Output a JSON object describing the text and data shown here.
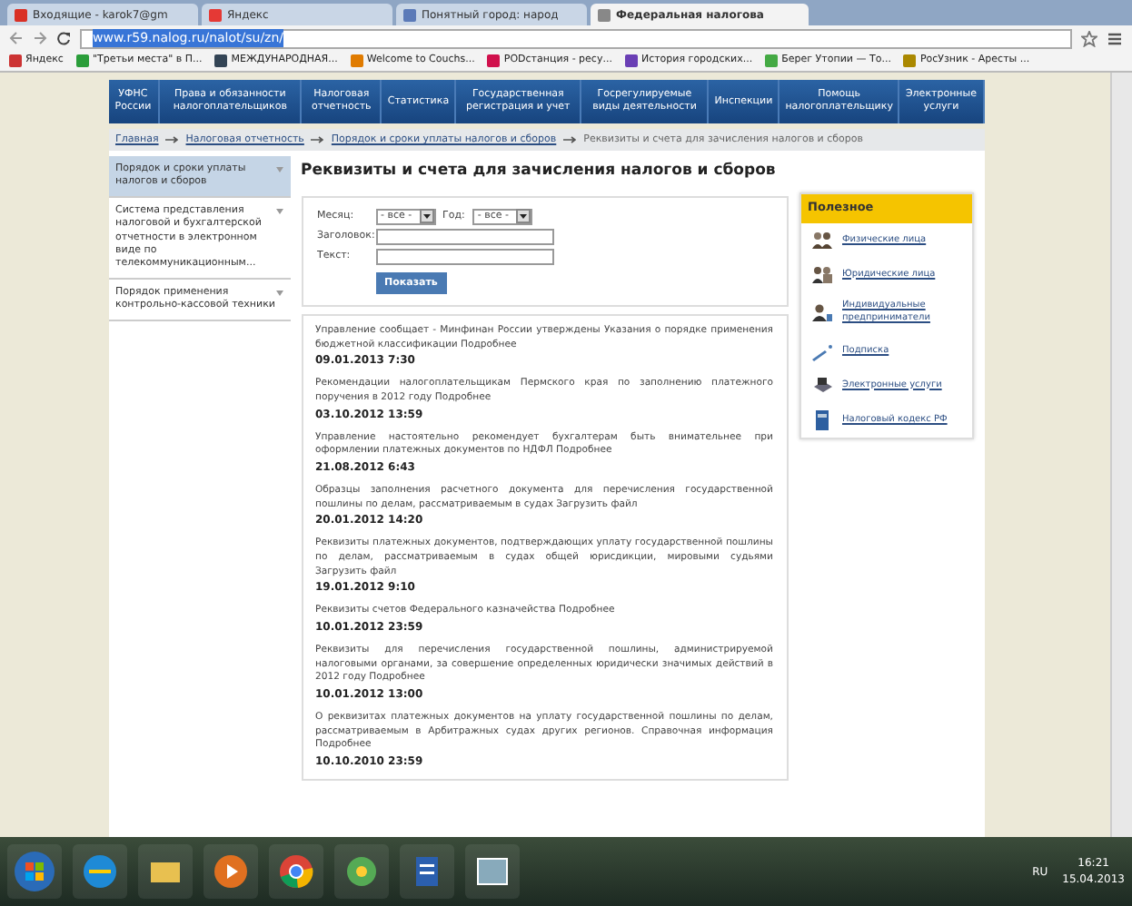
{
  "browser": {
    "tabs": [
      {
        "title": "Входящие - karok7@gm",
        "selected": false
      },
      {
        "title": "Яндекс",
        "selected": false
      },
      {
        "title": "Понятный город: народ",
        "selected": false
      },
      {
        "title": "Федеральная налогова",
        "selected": true
      }
    ],
    "address": "www.r59.nalog.ru/nalot/su/zn/",
    "bookmarks": [
      "Яндекс",
      "\"Третьи места\" в П...",
      "МЕЖДУНАРОДНАЯ...",
      "Welcome to Couchs...",
      "РОDстанция - ресу...",
      "История городских...",
      "Берег Утопии — То...",
      "РосУзник - Аресты ..."
    ]
  },
  "site": {
    "nav": [
      "УФНС России",
      "Права и обязанности налогоплательщиков",
      "Налоговая отчетность",
      "Статистика",
      "Государственная регистрация и учет",
      "Госрегулируемые виды деятельности",
      "Инспекции",
      "Помощь налогоплательщику",
      "Электронные услуги"
    ],
    "breadcrumb": [
      {
        "label": "Главная",
        "link": true
      },
      {
        "label": "Налоговая отчетность",
        "link": true
      },
      {
        "label": "Порядок и сроки уплаты налогов и сборов",
        "link": true
      },
      {
        "label": "Реквизиты и счета для зачисления налогов и сборов",
        "link": false
      }
    ],
    "sidebar": [
      {
        "label": "Порядок и сроки уплаты налогов и сборов",
        "selected": true
      },
      {
        "label": "Система представления налоговой и бухгалтерской отчетности в электронном виде по телекоммуникационным...",
        "selected": false
      },
      {
        "label": "Порядок применения контрольно-кассовой техники",
        "selected": false
      }
    ],
    "title": "Реквизиты и счета для зачисления налогов и сборов",
    "filter": {
      "month_label": "Месяц:",
      "month_value": "- все -",
      "year_label": "Год:",
      "year_value": "- все -",
      "heading_label": "Заголовок:",
      "text_label": "Текст:",
      "button": "Показать"
    },
    "news": [
      {
        "text": "Управление сообщает - Минфинан России утверждены Указания о порядке применения бюджетной классификации",
        "link": "Подробнее",
        "date": "09.01.2013 7:30"
      },
      {
        "text": "Рекомендации налогоплательщикам Пермского края по заполнению платежного поручения в 2012 году",
        "link": "Подробнее",
        "date": "03.10.2012 13:59"
      },
      {
        "text": "Управление настоятельно рекомендует бухгалтерам быть внимательнее при оформлении платежных документов по НДФЛ",
        "link": "Подробнее",
        "date": "21.08.2012 6:43"
      },
      {
        "text": "Образцы заполнения расчетного документа для перечисления государственной пошлины по делам, рассматриваемым в судах",
        "link": "Загрузить файл",
        "date": "20.01.2012 14:20"
      },
      {
        "text": "Реквизиты платежных документов, подтверждающих уплату государственной пошлины по делам, рассматриваемым в судах общей юрисдикции, мировыми судьями",
        "link": "Загрузить файл",
        "date": "19.01.2012 9:10"
      },
      {
        "text": "Реквизиты счетов Федерального казначейства",
        "link": "Подробнее",
        "date": "10.01.2012 23:59"
      },
      {
        "text": "Реквизиты для перечисления государственной пошлины, администрируемой налоговыми органами, за совершение определенных юридически значимых действий в 2012 году",
        "link": "Подробнее",
        "date": "10.01.2012 13:00"
      },
      {
        "text": "О реквизитах платежных документов на уплату государственной пошлины по делам, рассматриваемым в Арбитражных судах других регионов. Справочная информация",
        "link": "Подробнее",
        "date": "10.10.2010 23:59"
      }
    ],
    "useful": {
      "title": "Полезное",
      "items": [
        "Физические лица",
        "Юридические лица",
        "Индивидуальные предприниматели",
        "Подписка",
        "Электронные услуги",
        "Налоговый кодекс РФ"
      ]
    }
  },
  "taskbar": {
    "language": "RU",
    "time": "16:21",
    "date": "15.04.2013"
  }
}
